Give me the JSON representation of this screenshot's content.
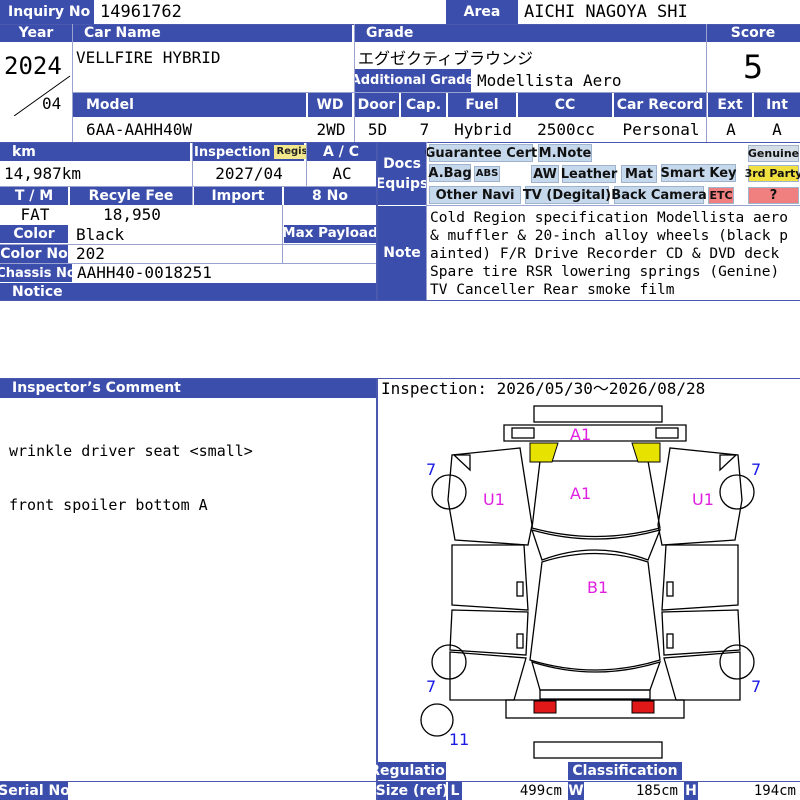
{
  "labels": {
    "inquiry": "Inquiry No",
    "area": "Area",
    "year": "Year",
    "car_name": "Car Name",
    "grade": "Grade",
    "score": "Score",
    "additional_grade": "Additional Grade",
    "model": "Model",
    "wd": "WD",
    "door": "Door",
    "cap": "Cap.",
    "fuel": "Fuel",
    "cc": "CC",
    "car_record": "Car Record",
    "ext": "Ext",
    "int": "Int",
    "km": "km",
    "inspection": "Inspection",
    "regist": "Regist",
    "ac": "A / C",
    "docs": "Docs",
    "equips": "Equips",
    "tm": "T / M",
    "recycle_fee": "Recyle Fee",
    "import": "Import",
    "no8": "8 No",
    "color": "Color",
    "max_payload": "Max Payload",
    "color_no": "Color No",
    "chassis_no": "Chassis No",
    "notice": "Notice",
    "note": "Note",
    "inspectors_comment": "Inspector’s Comment",
    "regulation": "Regulation",
    "classification": "Classification",
    "size_ref": "Size (ref)",
    "serial_no": "Serial No",
    "l": "L",
    "w": "W",
    "h": "H"
  },
  "vehicle": {
    "inquiry_no": "14961762",
    "area": "AICHI NAGOYA SHI",
    "year": "2024",
    "month": "04",
    "car_name": "VELLFIRE  HYBRID",
    "grade": "エグゼクティブラウンジ",
    "additional_grade": "Modellista Aero",
    "score": "5",
    "model": "6AA-AAHH40W",
    "wd": "2WD",
    "door": "5D",
    "cap": "7",
    "fuel": "Hybrid",
    "cc": "2500cc",
    "car_record": "Personal",
    "ext": "A",
    "int": "A",
    "km": "14,987km",
    "inspection": "2027/04",
    "ac": "AC",
    "tm": "FAT",
    "recycle_fee": "18,950",
    "color": "Black",
    "color_no": "202",
    "chassis_no": "AAHH40-0018251"
  },
  "equips": {
    "guarantee_cert": "Guarantee Cert",
    "m_note": "M.Note",
    "genuine": "Genuine",
    "a_bag": "A.Bag",
    "abs": "ABS",
    "aw": "AW",
    "leather": "Leather",
    "mat": "Mat",
    "smart_key": "Smart Key",
    "third_party": "3rd Party",
    "other_navi": "Other Navi",
    "tv": "TV (Degital)",
    "back_camera": "Back Camera",
    "etc": "ETC",
    "question": "?"
  },
  "note_text": "Cold Region specification Modellista aero & muffler & 20-inch alloy wheels (black painted) F/R Drive Recorder CD & DVD deck Spare tire RSR lowering springs (Genine) TV Canceller Rear smoke film",
  "comment": {
    "line1": "wrinkle driver seat <small>",
    "line2": "front spoiler bottom A"
  },
  "inspection_period": "Inspection: 2026/05/30～2026/08/28",
  "damage_marks": {
    "front": "A1",
    "hood": "A1",
    "left_side": "U1",
    "right_side": "U1",
    "roof": "B1",
    "wheel_fl": "7",
    "wheel_fr": "7",
    "wheel_rl": "7",
    "wheel_rr": "7",
    "spare": "11"
  },
  "size": {
    "l": "499cm",
    "w": "185cm",
    "h": "194cm"
  },
  "colors": {
    "header": "#3c4eab",
    "mark_magenta": "#e020e0",
    "mark_blue": "#1a1ae6",
    "light_yellow": "#e8e200",
    "tail_red": "#e01818"
  }
}
